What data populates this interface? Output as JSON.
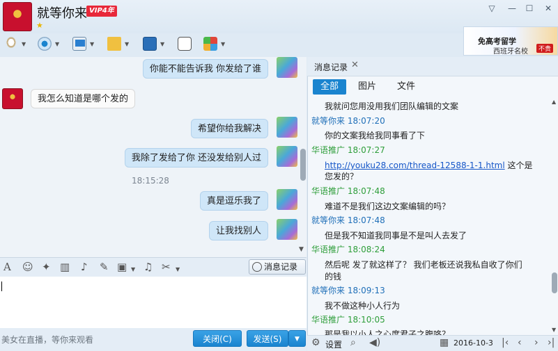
{
  "window": {
    "contact_name": "就等你来",
    "vip_badge": "VIP4年",
    "controls": [
      "▽",
      "—",
      "☐",
      "✕"
    ]
  },
  "ad": {
    "line1": "免高考留学",
    "line2": "西班牙名校",
    "badge": "不贵"
  },
  "chat": {
    "messages": [
      {
        "dir": "out",
        "text": "你能不能告诉我   你发给了谁"
      },
      {
        "dir": "in",
        "text": "我怎么知道是哪个发的"
      },
      {
        "dir": "out",
        "text": "希望你给我解决"
      },
      {
        "dir": "out",
        "text": "我除了发给了你  还没发给别人过"
      },
      {
        "dir": "time",
        "text": "18:15:28"
      },
      {
        "dir": "out",
        "text": "真是逗乐我了"
      },
      {
        "dir": "out",
        "text": "让我找别人"
      }
    ]
  },
  "input_toolbar": {
    "history_label": "消息记录"
  },
  "bottom": {
    "hint": "美女在直播，等你来观看",
    "close_label": "关闭(C)",
    "send_label": "发送(S)"
  },
  "history": {
    "title": "消息记录",
    "tabs": [
      "全部",
      "图片",
      "文件"
    ],
    "entries": [
      {
        "type": "msg",
        "text": "我就问您用没用我们团队编辑的文案"
      },
      {
        "type": "me",
        "text": "就等你来  18:07:20"
      },
      {
        "type": "msg",
        "text": "你的文案我给我同事看了下"
      },
      {
        "type": "them",
        "text": "华语推广  18:07:27"
      },
      {
        "type": "link",
        "url": "http://youku28.com/thread-12588-1-1.html",
        "after": "  这个是"
      },
      {
        "type": "msg",
        "text": "您发的？"
      },
      {
        "type": "them",
        "text": "华语推广  18:07:48"
      },
      {
        "type": "msg",
        "text": "难道不是我们这边文案编辑的吗？"
      },
      {
        "type": "me",
        "text": "就等你来  18:07:48"
      },
      {
        "type": "msg",
        "text": "但是我不知道我同事是不是叫人去发了"
      },
      {
        "type": "them",
        "text": "华语推广  18:08:24"
      },
      {
        "type": "msg",
        "text": "然后呢  发了就这样了？  我们老板还说我私自收了你们"
      },
      {
        "type": "msg",
        "text": "的钱"
      },
      {
        "type": "me",
        "text": "就等你来  18:09:13"
      },
      {
        "type": "msg",
        "text": "我不做这种小人行为"
      },
      {
        "type": "them",
        "text": "华语推广  18:10:05"
      },
      {
        "type": "msg",
        "text": "那是我以小人之心度君子之腹咯？"
      }
    ],
    "settings_label": "设置",
    "date": "2016-10-3"
  }
}
